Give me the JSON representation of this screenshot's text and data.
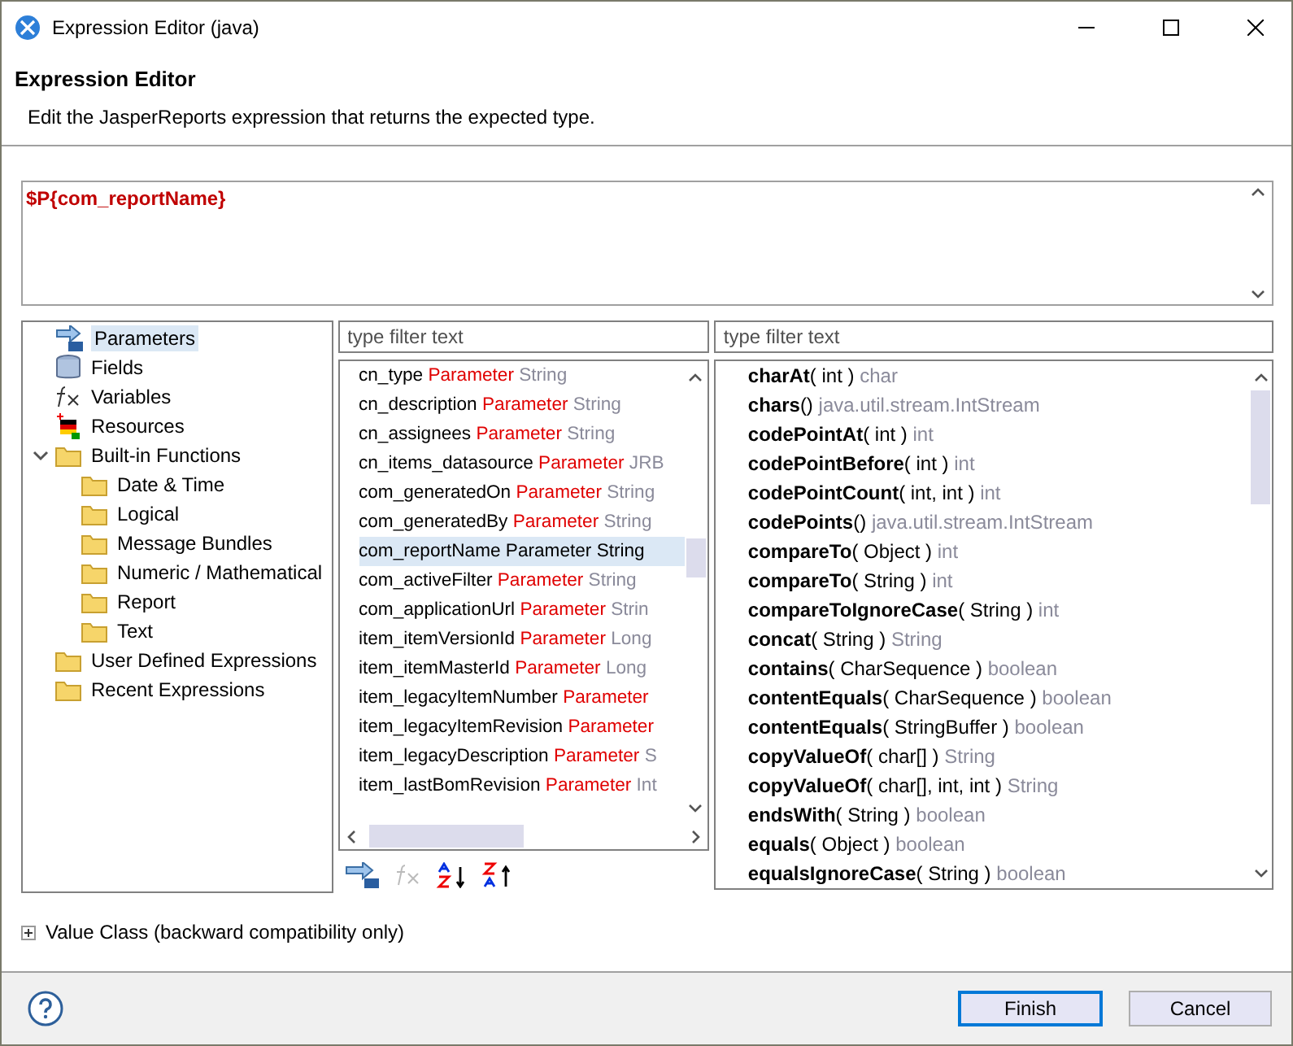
{
  "window": {
    "title": "Expression Editor (java)"
  },
  "header": {
    "title": "Expression Editor",
    "description": "Edit the JasperReports expression that returns the expected type."
  },
  "expression": "$P{com_reportName}",
  "tree": [
    {
      "label": "Parameters",
      "kind": "parameters",
      "selected": true
    },
    {
      "label": "Fields",
      "kind": "fields",
      "selected": false
    },
    {
      "label": "Variables",
      "kind": "variables",
      "selected": false
    },
    {
      "label": "Resources",
      "kind": "resources",
      "selected": false
    },
    {
      "label": "Built-in Functions",
      "kind": "folder",
      "selected": false,
      "expanded": true,
      "children": [
        {
          "label": "Date & Time",
          "kind": "folder",
          "selected": false
        },
        {
          "label": "Logical",
          "kind": "folder",
          "selected": false
        },
        {
          "label": "Message Bundles",
          "kind": "folder",
          "selected": false
        },
        {
          "label": "Numeric / Mathematical",
          "kind": "folder",
          "selected": false
        },
        {
          "label": "Report",
          "kind": "folder",
          "selected": false
        },
        {
          "label": "Text",
          "kind": "folder",
          "selected": false
        }
      ]
    },
    {
      "label": "User Defined Expressions",
      "kind": "folder",
      "selected": false
    },
    {
      "label": "Recent Expressions",
      "kind": "folder",
      "selected": false
    }
  ],
  "parameters_filter": {
    "placeholder": "type filter text"
  },
  "parameters": [
    {
      "name": "cn_type",
      "kind": "Parameter",
      "type": "String",
      "selected": false
    },
    {
      "name": "cn_description",
      "kind": "Parameter",
      "type": "String",
      "selected": false
    },
    {
      "name": "cn_assignees",
      "kind": "Parameter",
      "type": "String",
      "selected": false
    },
    {
      "name": "cn_items_datasource",
      "kind": "Parameter",
      "type": "JRB",
      "selected": false
    },
    {
      "name": "com_generatedOn",
      "kind": "Parameter",
      "type": "String",
      "selected": false
    },
    {
      "name": "com_generatedBy",
      "kind": "Parameter",
      "type": "String",
      "selected": false
    },
    {
      "name": "com_reportName",
      "kind": "Parameter",
      "type": "String",
      "selected": true
    },
    {
      "name": "com_activeFilter",
      "kind": "Parameter",
      "type": "String",
      "selected": false
    },
    {
      "name": "com_applicationUrl",
      "kind": "Parameter",
      "type": "Strin",
      "selected": false
    },
    {
      "name": "item_itemVersionId",
      "kind": "Parameter",
      "type": "Long",
      "selected": false
    },
    {
      "name": "item_itemMasterId",
      "kind": "Parameter",
      "type": "Long",
      "selected": false
    },
    {
      "name": "item_legacyItemNumber",
      "kind": "Parameter",
      "selected": false
    },
    {
      "name": "item_legacyItemRevision",
      "kind": "Parameter",
      "selected": false
    },
    {
      "name": "item_legacyDescription",
      "kind": "Parameter",
      "type": "S",
      "selected": false
    },
    {
      "name": "item_lastBomRevision",
      "kind": "Parameter",
      "type": "Int",
      "selected": false
    }
  ],
  "functions_filter": {
    "placeholder": "type filter text"
  },
  "functions": [
    {
      "name": "charAt",
      "args": "( int )",
      "returns": "char"
    },
    {
      "name": "chars",
      "args": "()",
      "returns": "java.util.stream.IntStream"
    },
    {
      "name": "codePointAt",
      "args": "( int )",
      "returns": "int"
    },
    {
      "name": "codePointBefore",
      "args": "( int )",
      "returns": "int"
    },
    {
      "name": "codePointCount",
      "args": "( int, int )",
      "returns": "int"
    },
    {
      "name": "codePoints",
      "args": "()",
      "returns": "java.util.stream.IntStream"
    },
    {
      "name": "compareTo",
      "args": "( Object )",
      "returns": "int"
    },
    {
      "name": "compareTo",
      "args": "( String )",
      "returns": "int"
    },
    {
      "name": "compareToIgnoreCase",
      "args": "( String )",
      "returns": "int"
    },
    {
      "name": "concat",
      "args": "( String )",
      "returns": "String"
    },
    {
      "name": "contains",
      "args": "( CharSequence )",
      "returns": "boolean"
    },
    {
      "name": "contentEquals",
      "args": "( CharSequence )",
      "returns": "boolean"
    },
    {
      "name": "contentEquals",
      "args": "( StringBuffer )",
      "returns": "boolean"
    },
    {
      "name": "copyValueOf",
      "args": "( char[] )",
      "returns": "String"
    },
    {
      "name": "copyValueOf",
      "args": "( char[], int, int )",
      "returns": "String"
    },
    {
      "name": "endsWith",
      "args": "( String )",
      "returns": "boolean"
    },
    {
      "name": "equals",
      "args": "( Object )",
      "returns": "boolean"
    },
    {
      "name": "equalsIgnoreCase",
      "args": "( String )",
      "returns": "boolean"
    }
  ],
  "value_class": {
    "label": "Value Class (backward compatibility only)",
    "expanded": false
  },
  "buttons": [
    {
      "label": "Finish",
      "default": true
    },
    {
      "label": "Cancel",
      "default": false
    }
  ]
}
